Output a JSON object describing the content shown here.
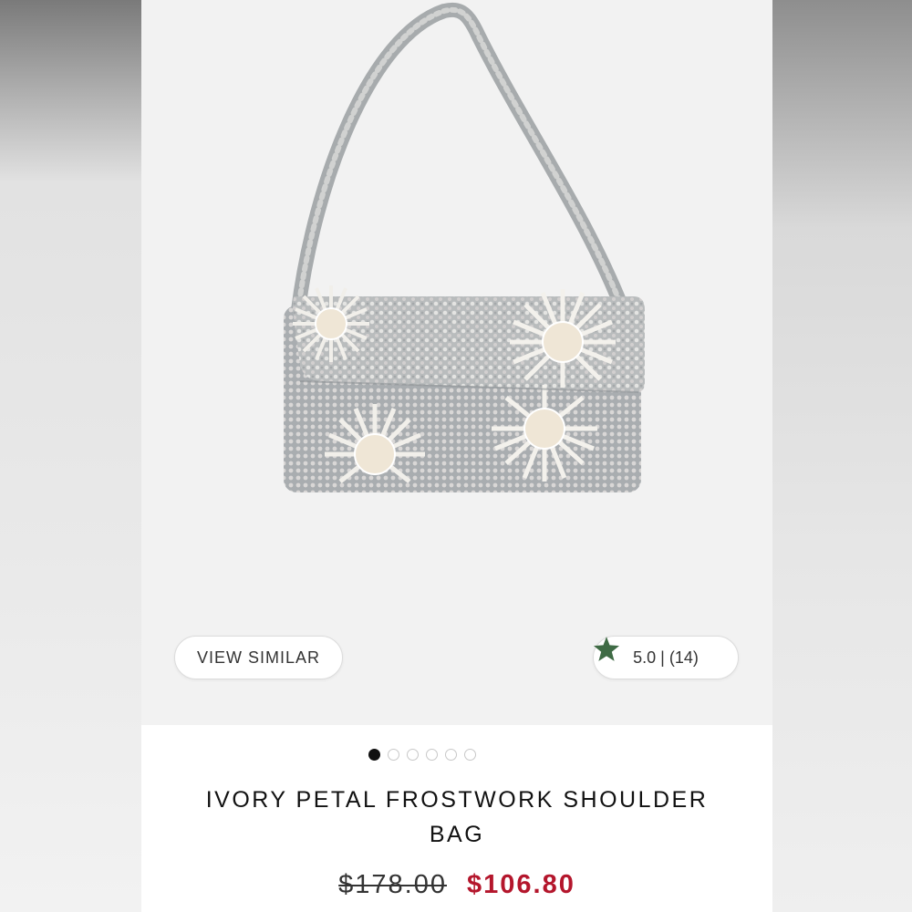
{
  "product": {
    "image_alt": "Beaded sequin shoulder bag with floral pattern",
    "title": "IVORY PETAL FROSTWORK SHOULDER BAG",
    "original_price": "$178.00",
    "sale_price": "$106.80"
  },
  "actions": {
    "view_similar_label": "VIEW SIMILAR",
    "rating_text": "5.0 | (14)",
    "rating_icon": "star-icon"
  },
  "carousel": {
    "total": 6,
    "active_index": 0
  },
  "colors": {
    "sale": "#b4162c",
    "star": "#3f6b45",
    "active_dot": "#111111"
  }
}
